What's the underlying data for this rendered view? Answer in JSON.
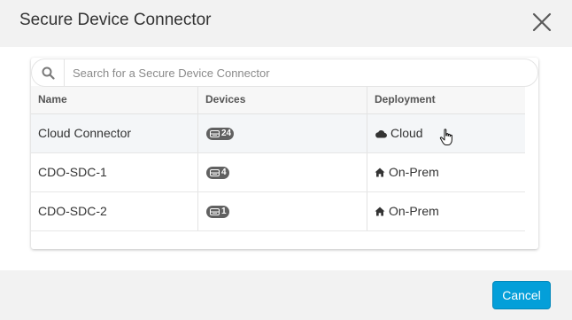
{
  "dialog": {
    "title": "Secure Device Connector",
    "close_icon": "close-icon"
  },
  "search": {
    "placeholder": "Search for a Secure Device Connector",
    "value": "",
    "icon": "search-icon"
  },
  "table": {
    "columns": [
      "Name",
      "Devices",
      "Deployment"
    ],
    "rows": [
      {
        "name": "Cloud Connector",
        "devices": "24",
        "deployment": "Cloud",
        "deployment_icon": "cloud-icon",
        "hovered": true
      },
      {
        "name": "CDO-SDC-1",
        "devices": "4",
        "deployment": "On-Prem",
        "deployment_icon": "home-icon",
        "hovered": false
      },
      {
        "name": "CDO-SDC-2",
        "devices": "1",
        "deployment": "On-Prem",
        "deployment_icon": "home-icon",
        "hovered": false
      }
    ]
  },
  "footer": {
    "cancel_label": "Cancel"
  },
  "colors": {
    "primary_button": "#049fd9",
    "badge": "#616161",
    "hover_row": "#f4f6f8"
  }
}
